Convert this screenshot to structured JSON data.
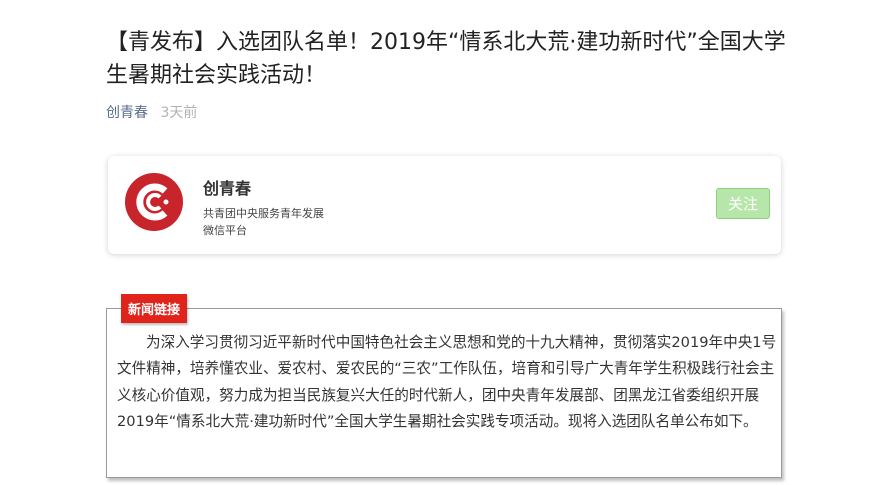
{
  "article": {
    "title": "【青发布】入选团队名单！2019年“情系北大荒·建功新时代”全国大学生暑期社会实践活动！",
    "author": "创青春",
    "time": "3天前"
  },
  "account_card": {
    "name": "创青春",
    "desc_line1": "共青团中央服务青年发展",
    "desc_line2": "微信平台",
    "follow_label": "关注",
    "logo_icon": "chuangqingchun-logo-icon",
    "colors": {
      "logo_red": "#c8242b",
      "follow_bg": "#b6e6a9"
    }
  },
  "news": {
    "tag": "新闻链接",
    "body": "为深入学习贯彻习近平新时代中国特色社会主义思想和党的十九大精神，贯彻落实2019年中央1号文件精神，培养懂农业、爱农村、爱农民的“三农”工作队伍，培育和引导广大青年学生积极践行社会主义核心价值观，努力成为担当民族复兴大任的时代新人，团中央青年发展部、团黑龙江省委组织开展2019年“情系北大荒·建功新时代”全国大学生暑期社会实践专项活动。现将入选团队名单公布如下。",
    "colors": {
      "tag_bg": "#e0231b"
    }
  }
}
